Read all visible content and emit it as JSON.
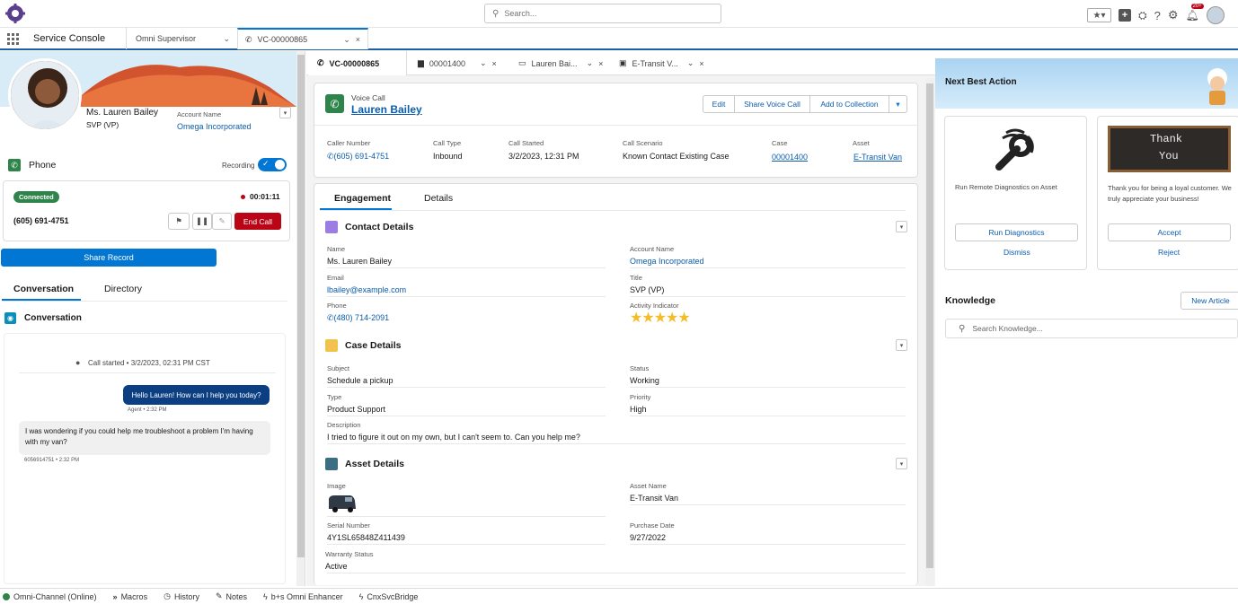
{
  "header": {
    "search_placeholder": "Search...",
    "notification_count": "20+"
  },
  "nav": {
    "app_name": "Service Console",
    "workspace_tab": "Omni Supervisor",
    "record_tab": "VC-00000865"
  },
  "subtabs": [
    {
      "label": "VC-00000865"
    },
    {
      "label": "00001400"
    },
    {
      "label": "Lauren Bai..."
    },
    {
      "label": "E-Transit V..."
    }
  ],
  "contact": {
    "name": "Ms. Lauren Bailey",
    "title": "SVP (VP)",
    "account_label": "Account Name",
    "account": "Omega Incorporated"
  },
  "phone": {
    "label": "Phone",
    "recording_label": "Recording",
    "status": "Connected",
    "timer": "00:01:11",
    "number": "(605) 691-4751",
    "end_call": "End Call",
    "share_record": "Share Record"
  },
  "conv_tabs": {
    "conversation": "Conversation",
    "directory": "Directory"
  },
  "conversation": {
    "title": "Conversation",
    "call_started": "Call started • 3/2/2023, 02:31 PM CST",
    "messages": [
      {
        "text": "Hello Lauren! How can I help you today?",
        "meta": "Agent • 2:32 PM"
      },
      {
        "text": "I was wondering if you could help me troubleshoot a problem I'm having with my van?",
        "meta": "6056914751 • 2:32 PM"
      }
    ]
  },
  "voicecall": {
    "type_label": "Voice Call",
    "name": "Lauren Bailey",
    "actions": {
      "edit": "Edit",
      "share": "Share Voice Call",
      "collection": "Add to Collection"
    },
    "caller_number_label": "Caller Number",
    "caller_number": "(605) 691-4751",
    "call_type_label": "Call Type",
    "call_type": "Inbound",
    "call_started_label": "Call Started",
    "call_started": "3/2/2023, 12:31 PM",
    "call_scenario_label": "Call Scenario",
    "call_scenario": "Known Contact Existing Case",
    "case_label": "Case",
    "case": "00001400",
    "asset_label": "Asset",
    "asset": "E-Transit Van"
  },
  "detail_tabs": {
    "engagement": "Engagement",
    "details": "Details"
  },
  "contact_details": {
    "title": "Contact Details",
    "name_label": "Name",
    "name": "Ms. Lauren Bailey",
    "account_label": "Account Name",
    "account": "Omega Incorporated",
    "email_label": "Email",
    "email": "lbailey@example.com",
    "title_label": "Title",
    "title_value": "SVP (VP)",
    "phone_label": "Phone",
    "phone": "(480) 714-2091",
    "activity_label": "Activity Indicator",
    "activity_rating": 5
  },
  "case_details": {
    "title": "Case Details",
    "subject_label": "Subject",
    "subject": "Schedule a pickup",
    "status_label": "Status",
    "status": "Working",
    "type_label": "Type",
    "type": "Product Support",
    "priority_label": "Priority",
    "priority": "High",
    "description_label": "Description",
    "description": "I tried to figure it out on my own, but I can't seem to. Can you help me?"
  },
  "asset_details": {
    "title": "Asset Details",
    "image_label": "Image",
    "asset_name_label": "Asset Name",
    "asset_name": "E-Transit Van",
    "serial_label": "Serial Number",
    "serial": "4Y1SL65848Z411439",
    "purchase_label": "Purchase Date",
    "purchase": "9/27/2022",
    "warranty_label": "Warranty Status",
    "warranty": "Active"
  },
  "nba": {
    "title": "Next Best Action",
    "card1": {
      "text": "Run Remote Diagnostics on Asset",
      "primary": "Run Diagnostics",
      "secondary": "Dismiss"
    },
    "card2": {
      "image_text_1": "Thank",
      "image_text_2": "You",
      "text": "Thank you for being a loyal customer. We truly appreciate your business!",
      "primary": "Accept",
      "secondary": "Reject"
    }
  },
  "knowledge": {
    "title": "Knowledge",
    "new_article": "New Article",
    "search_placeholder": "Search Knowledge..."
  },
  "footer": {
    "items": [
      "Omni-Channel (Online)",
      "Macros",
      "History",
      "Notes",
      "b+s Omni Enhancer",
      "CnxSvcBridge"
    ]
  },
  "colors": {
    "brand": "#0b5cab",
    "end_call": "#ba0517",
    "connected": "#2e844a",
    "accent_blue": "#0176d3"
  }
}
